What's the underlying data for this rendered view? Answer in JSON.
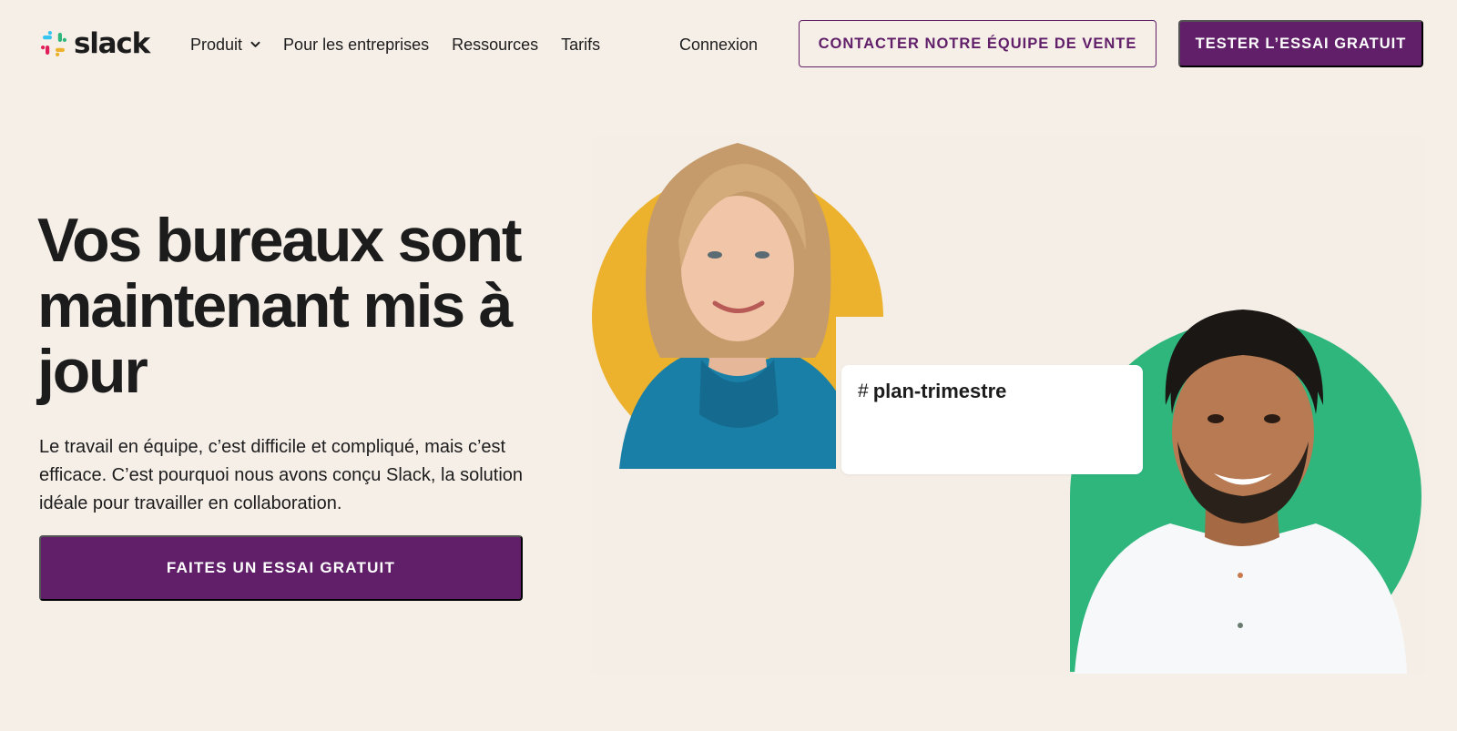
{
  "header": {
    "logo_text": "slack",
    "logo_icon": "slack-hash-logo",
    "nav": [
      {
        "label": "Produit",
        "has_dropdown": true
      },
      {
        "label": "Pour les entreprises",
        "has_dropdown": false
      },
      {
        "label": "Ressources",
        "has_dropdown": false
      },
      {
        "label": "Tarifs",
        "has_dropdown": false
      }
    ],
    "signin": "Connexion",
    "contact_sales": "CONTACTER NOTRE ÉQUIPE DE VENTE",
    "try_free": "TESTER L’ESSAI GRATUIT"
  },
  "hero": {
    "title": "Vos bureaux sont maintenant mis à jour",
    "description": "Le travail en équipe, c’est difficile et compliqué, mais c’est efficace. C’est pourquoi nous avons conçu Slack, la solution idéale pour travailler en collaboration.",
    "cta": "FAITES UN ESSAI GRATUIT"
  },
  "illustration": {
    "channel_hash": "#",
    "channel_name": "plan-trimestre"
  },
  "colors": {
    "background": "#f5efe8",
    "brand_aubergine": "#611f69",
    "circle_yellow": "#ecb22e",
    "circle_green": "#2eb67d",
    "text": "#1d1c1d"
  }
}
